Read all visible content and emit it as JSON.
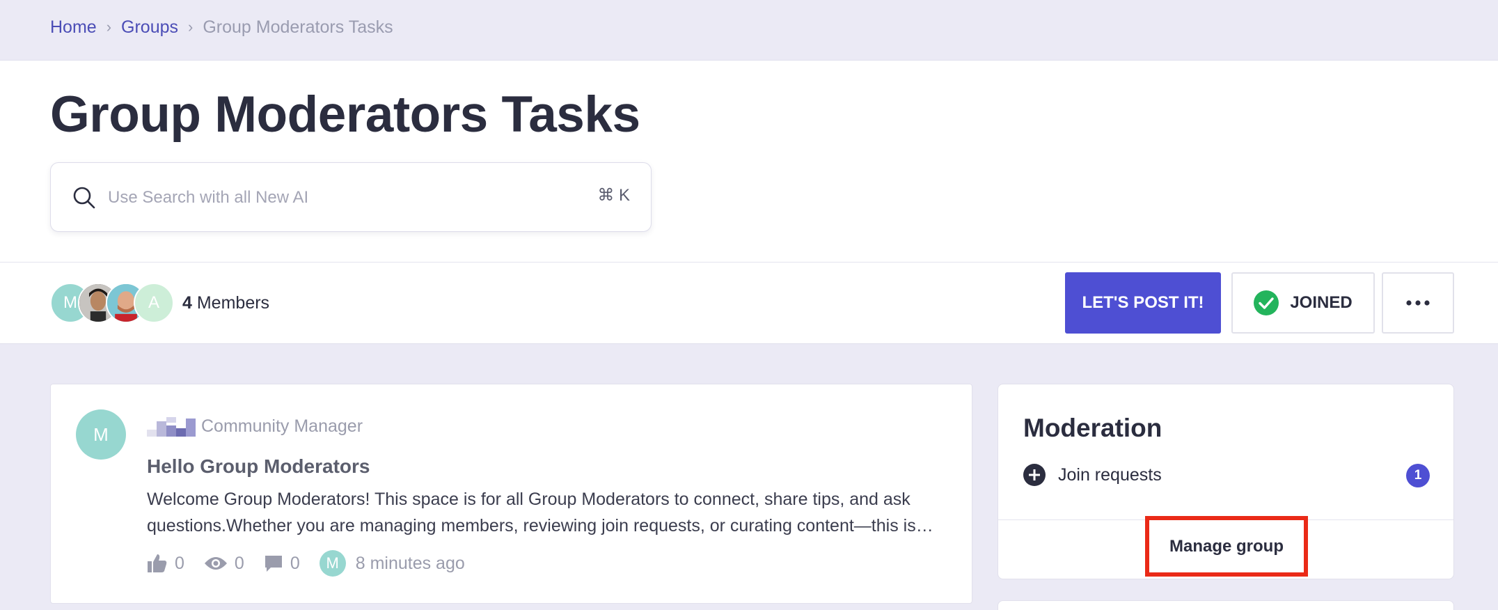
{
  "breadcrumb": {
    "home": "Home",
    "groups": "Groups",
    "current": "Group Moderators Tasks"
  },
  "page": {
    "title": "Group Moderators Tasks"
  },
  "search": {
    "placeholder": "Use Search with all New AI",
    "shortcut": "⌘ K"
  },
  "members": {
    "count": "4",
    "label": "Members",
    "avatars": [
      {
        "initial": "M",
        "color": "#97d7d0"
      },
      {
        "initial": "",
        "color": "#3a3a3a"
      },
      {
        "initial": "",
        "color": "#6cb8c7"
      },
      {
        "initial": "A",
        "color": "#cdeed8"
      }
    ]
  },
  "actions": {
    "post": "LET'S POST IT!",
    "joined": "JOINED",
    "more_icon": "more-horizontal-icon"
  },
  "post": {
    "avatar_initial": "M",
    "author_role": "Community Manager",
    "title": "Hello Group Moderators",
    "body": "Welcome Group Moderators! This space is for all Group Moderators to connect, share tips, and ask questions.Whether you are managing members, reviewing join requests, or curating content—this is…",
    "likes": "0",
    "views": "0",
    "comments": "0",
    "reply_avatar_initial": "M",
    "time": "8 minutes ago"
  },
  "moderation": {
    "title": "Moderation",
    "join_requests_label": "Join requests",
    "join_requests_count": "1",
    "manage_label": "Manage group"
  },
  "colors": {
    "accent": "#4e4fd3",
    "success": "#23b45c",
    "highlight": "#ea2a17",
    "background": "#ebeaf5"
  }
}
